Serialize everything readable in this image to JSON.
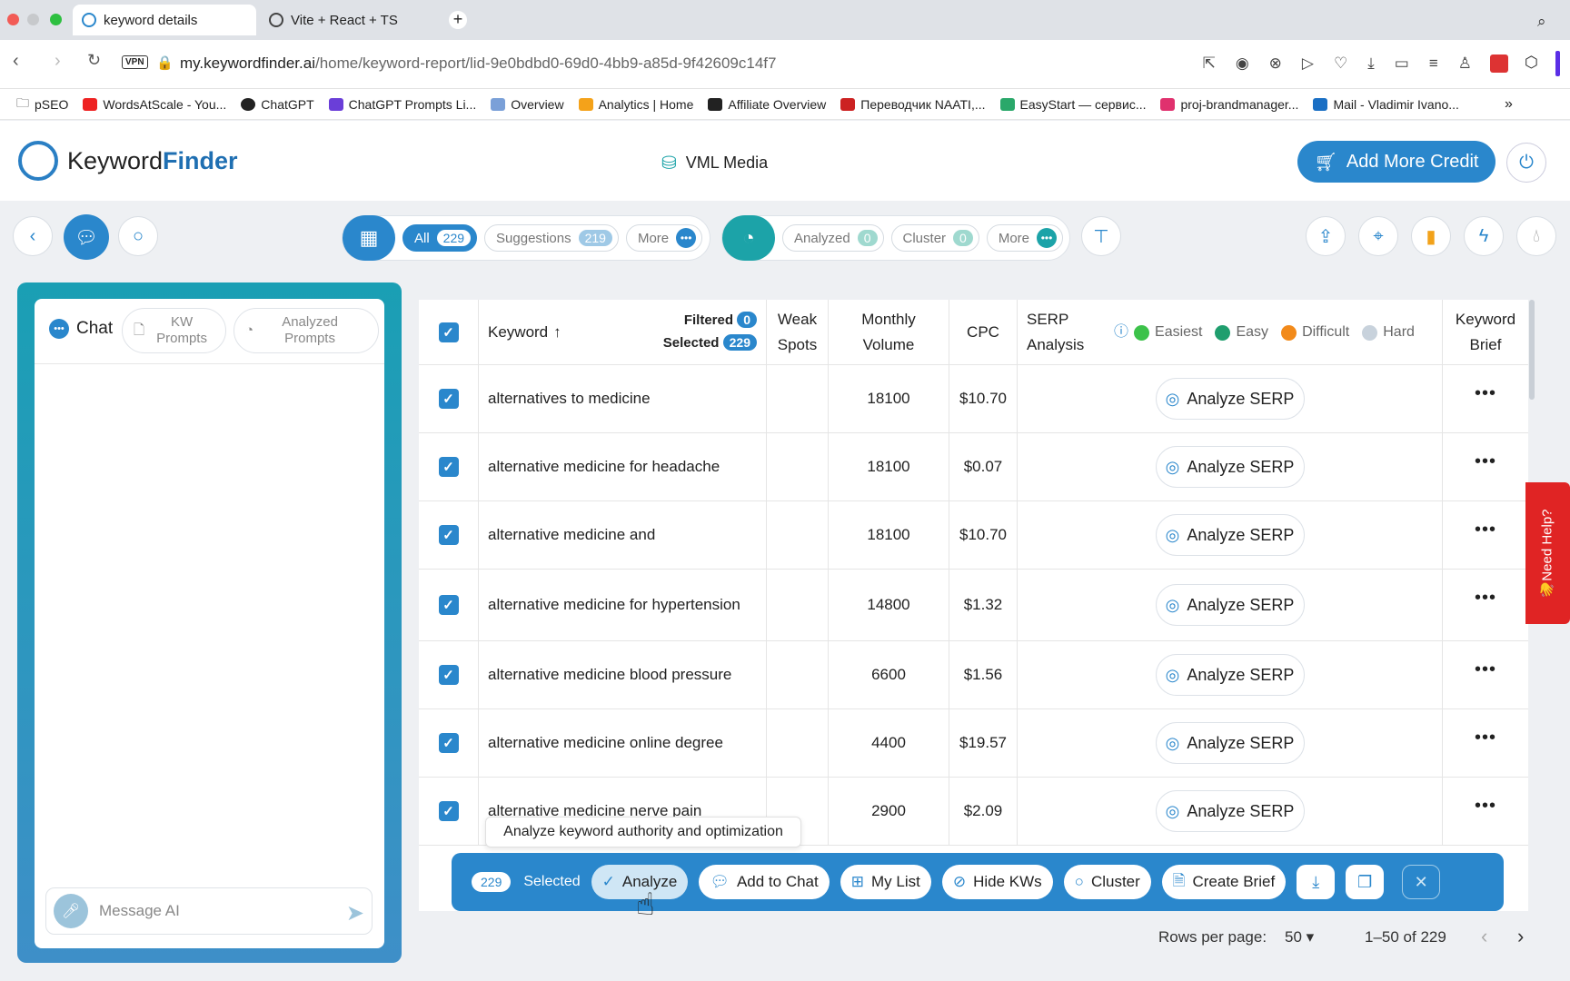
{
  "browser": {
    "tabs": [
      {
        "title": "keyword details"
      },
      {
        "title": "Vite + React + TS"
      }
    ],
    "url_host": "my.keywordfinder.ai",
    "url_path": "/home/keyword-report/lid-9e0bdbd0-69d0-4bb9-a85d-9f42609c14f7",
    "vpn": "VPN",
    "bookmarks": [
      "pSEO",
      "WordsAtScale - You...",
      "ChatGPT",
      "ChatGPT Prompts Li...",
      "Overview",
      "Analytics | Home",
      "Affiliate Overview",
      "Переводчик NAATI,...",
      "EasyStart — сервис...",
      "proj-brandmanager...",
      "Mail - Vladimir Ivano..."
    ]
  },
  "app": {
    "logo_a": "Keyword",
    "logo_b": "Finder",
    "workspace": "VML Media",
    "add_credit": "Add More Credit"
  },
  "filters": {
    "all_label": "All",
    "all_count": "229",
    "suggestions_label": "Suggestions",
    "suggestions_count": "219",
    "more1": "More",
    "analyzed_label": "Analyzed",
    "analyzed_count": "0",
    "cluster_label": "Cluster",
    "cluster_count": "0",
    "more2": "More"
  },
  "chat": {
    "tab_chat": "Chat",
    "tab_kw_prompts": "KW Prompts",
    "tab_analyzed_prompts": "Analyzed Prompts",
    "placeholder": "Message AI"
  },
  "table": {
    "headers": {
      "keyword": "Keyword",
      "filtered": "Filtered",
      "filtered_count": "0",
      "selected": "Selected",
      "selected_count": "229",
      "weak_spots": "Weak Spots",
      "monthly_volume": "Monthly Volume",
      "cpc": "CPC",
      "serp": "SERP Analysis",
      "easiest": "Easiest",
      "easy": "Easy",
      "difficult": "Difficult",
      "hard": "Hard",
      "brief": "Keyword Brief"
    },
    "analyze_label": "Analyze SERP",
    "rows": [
      {
        "keyword": "alternatives to medicine",
        "volume": "18100",
        "cpc": "$10.70"
      },
      {
        "keyword": "alternative medicine for headache",
        "volume": "18100",
        "cpc": "$0.07"
      },
      {
        "keyword": "alternative medicine and",
        "volume": "18100",
        "cpc": "$10.70"
      },
      {
        "keyword": "alternative medicine for hypertension",
        "volume": "14800",
        "cpc": "$1.32"
      },
      {
        "keyword": "alternative medicine blood pressure",
        "volume": "6600",
        "cpc": "$1.56"
      },
      {
        "keyword": "alternative medicine online degree",
        "volume": "4400",
        "cpc": "$19.57"
      },
      {
        "keyword": "alternative medicine nerve pain",
        "volume": "2900",
        "cpc": "$2.09"
      }
    ]
  },
  "actions": {
    "selected_count": "229",
    "selected_label": "Selected",
    "analyze": "Analyze",
    "add_to_chat": "Add to Chat",
    "my_list": "My List",
    "hide_kws": "Hide KWs",
    "cluster": "Cluster",
    "create_brief": "Create Brief",
    "tooltip": "Analyze keyword authority and optimization"
  },
  "pager": {
    "rows_label": "Rows per page:",
    "rows_value": "50",
    "range": "1–50 of 229"
  },
  "help": "👋Need Help?",
  "colors": {
    "accent": "#2a87cc",
    "teal": "#1ca3a8",
    "easiest": "#3cc24a",
    "easy": "#1f9e6e",
    "difficult": "#f28a1a",
    "hard": "#c8d2dc"
  }
}
